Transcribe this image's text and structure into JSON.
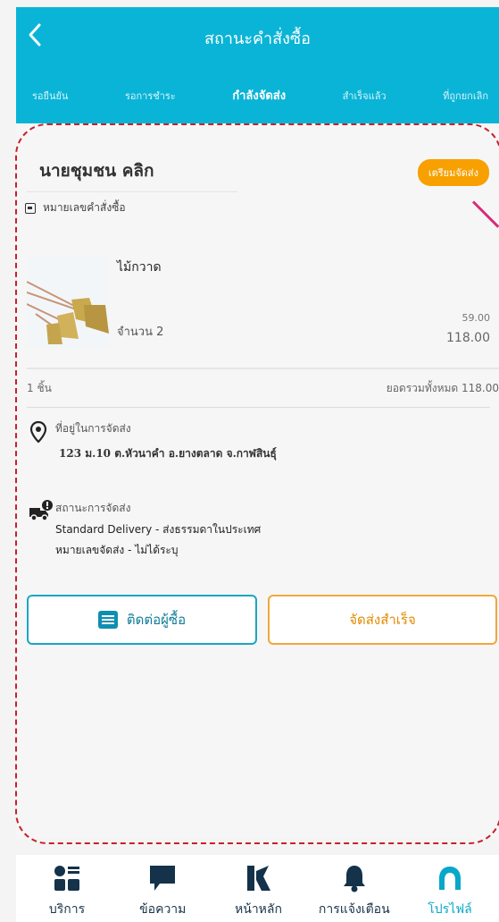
{
  "header": {
    "title": "สถานะคำสั่งซื้อ",
    "tabs": [
      {
        "label": "รอยืนยัน"
      },
      {
        "label": "รอการชำระ"
      },
      {
        "label": "กำลังจัดส่ง"
      },
      {
        "label": "สำเร็จแล้ว"
      },
      {
        "label": "ที่ถูกยกเลิก"
      }
    ]
  },
  "order": {
    "customer_name": "นายชุมชน คลิก",
    "status_badge": "เตรียมจัดส่ง",
    "order_number_label": "หมายเลขคำสั่งซื้อ",
    "product": {
      "name": "ไม้กวาด",
      "quantity": "จำนวน 2",
      "unit_price": "59.00",
      "line_total": "118.00"
    },
    "summary": {
      "pieces": "1 ชิ้น",
      "grand_total": "ยอดรวมทั้งหมด 118.00"
    },
    "address": {
      "label": "ที่อยู่ในการจัดส่ง",
      "value": "123 ม.10 ต.หัวนาคำ อ.ยางตลาด จ.กาฬสินธุ์"
    },
    "shipping": {
      "label": "สถานะการจัดส่ง",
      "method": "Standard Delivery - ส่งธรรมดาในประเทศ",
      "tracking": "หมายเลขจัดส่ง - ไม่ได้ระบุ"
    },
    "buttons": {
      "contact_buyer": "ติดต่อผู้ซื้อ",
      "delivered": "จัดส่งสำเร็จ"
    }
  },
  "bottom_nav": {
    "items": [
      {
        "label": "บริการ",
        "icon": "services-icon"
      },
      {
        "label": "ข้อความ",
        "icon": "message-icon"
      },
      {
        "label": "หน้าหลัก",
        "icon": "home-k-icon"
      },
      {
        "label": "การแจ้งเตือน",
        "icon": "bell-icon"
      },
      {
        "label": "โปรไฟล์",
        "icon": "profile-icon"
      }
    ],
    "active": "โปรไฟล์"
  },
  "colors": {
    "header_bg": "#0ab4d6",
    "badge_bg": "#f7a000",
    "annotation_dash": "#c8202a",
    "active_nav": "#09a7c9"
  }
}
